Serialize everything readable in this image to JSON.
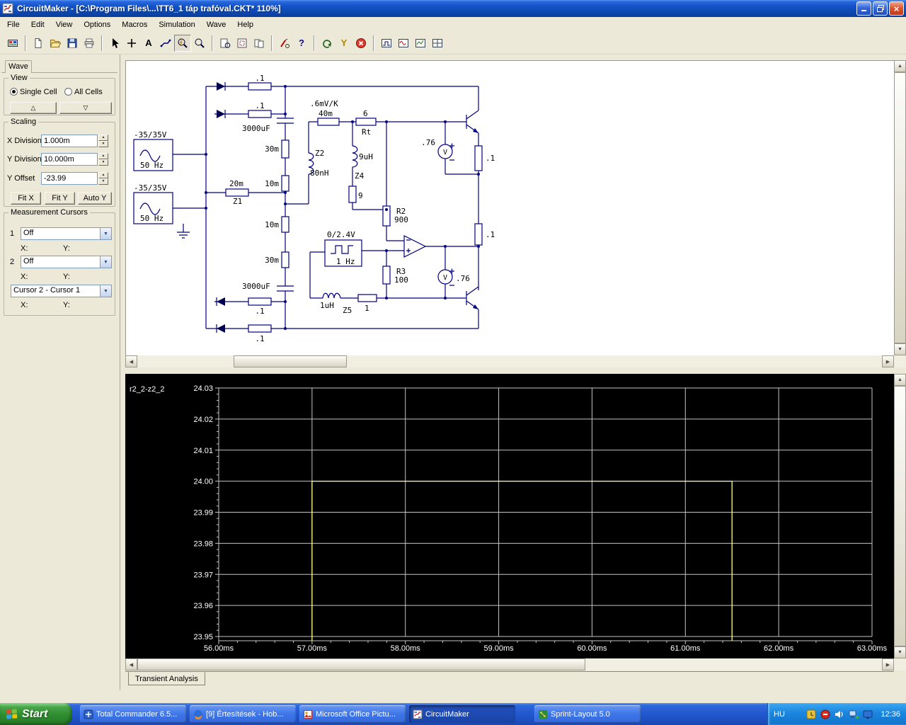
{
  "window": {
    "title": "CircuitMaker - [C:\\Program Files\\...\\TT6_1 táp trafóval.CKT* 110%]"
  },
  "menu": [
    "File",
    "Edit",
    "View",
    "Options",
    "Macros",
    "Simulation",
    "Wave",
    "Help"
  ],
  "toolbar": {
    "glyphs": {
      "text_tool": "A",
      "help": "?",
      "test_probe": "Y"
    }
  },
  "sidebar": {
    "tab_label": "Wave",
    "view": {
      "title": "View",
      "single_cell": "Single Cell",
      "all_cells": "All Cells",
      "up_glyph": "△",
      "down_glyph": "▽"
    },
    "scaling": {
      "title": "Scaling",
      "x_division_label": "X Division",
      "x_division": "1.000m",
      "y_division_label": "Y Division",
      "y_division": "10.000m",
      "y_offset_label": "Y Offset",
      "y_offset": "-23.99",
      "fit_x": "Fit X",
      "fit_y": "Fit Y",
      "auto_y": "Auto Y"
    },
    "cursors": {
      "title": "Measurement Cursors",
      "row1_label": "1",
      "row1_value": "Off",
      "row2_label": "2",
      "row2_value": "Off",
      "x_label": "X:",
      "y_label": "Y:",
      "diff_value": "Cursor 2 - Cursor 1"
    }
  },
  "circuit": {
    "labels": [
      ".1",
      ".1",
      "3000uF",
      "-35/35V",
      "50 Hz",
      "-35/35V",
      "50 Hz",
      "20m",
      "Z1",
      "30m",
      "10m",
      "10m",
      "30m",
      ".6mV/K",
      "40m",
      "6",
      "Rt",
      "Z2",
      "80nH",
      "9uH",
      "Z4",
      "9",
      "R2",
      "900",
      "0/2.4V",
      "1 Hz",
      "R3",
      "100",
      "1uH",
      "Z5",
      "1",
      "3000uF",
      ".1",
      ".1",
      ".76",
      ".1",
      ".1",
      ".76",
      "V",
      "V"
    ]
  },
  "wave_panel": {
    "trace_label": "r2_2-z2_2",
    "tab_label": "Transient Analysis"
  },
  "chart_data": {
    "type": "line",
    "title": "",
    "xlim": [
      56.0,
      63.0
    ],
    "ylim": [
      23.95,
      24.03
    ],
    "x_ticks": [
      "56.00ms",
      "57.00ms",
      "58.00ms",
      "59.00ms",
      "60.00ms",
      "61.00ms",
      "62.00ms",
      "63.00ms"
    ],
    "y_ticks": [
      "24.03",
      "24.02",
      "24.01",
      "24.00",
      "23.99",
      "23.98",
      "23.97",
      "23.96",
      "23.95"
    ],
    "grid": true,
    "legend": "none",
    "series": [
      {
        "name": "r2_2-z2_2",
        "color": "#ffff7d",
        "baseline_offscale_low": true,
        "points": [
          [
            57.0,
            23.944
          ],
          [
            57.0,
            24.0
          ],
          [
            61.5,
            24.0
          ],
          [
            61.5,
            23.944
          ]
        ]
      }
    ]
  },
  "taskbar": {
    "start_label": "Start",
    "tasks": [
      "Total Commander 6.5...",
      "[9] Értesítések - Hob...",
      "Microsoft Office Pictu...",
      "CircuitMaker",
      "Sprint-Layout 5.0"
    ],
    "active_task": "CircuitMaker",
    "language_indicator": "HU",
    "clock": "12:36"
  }
}
